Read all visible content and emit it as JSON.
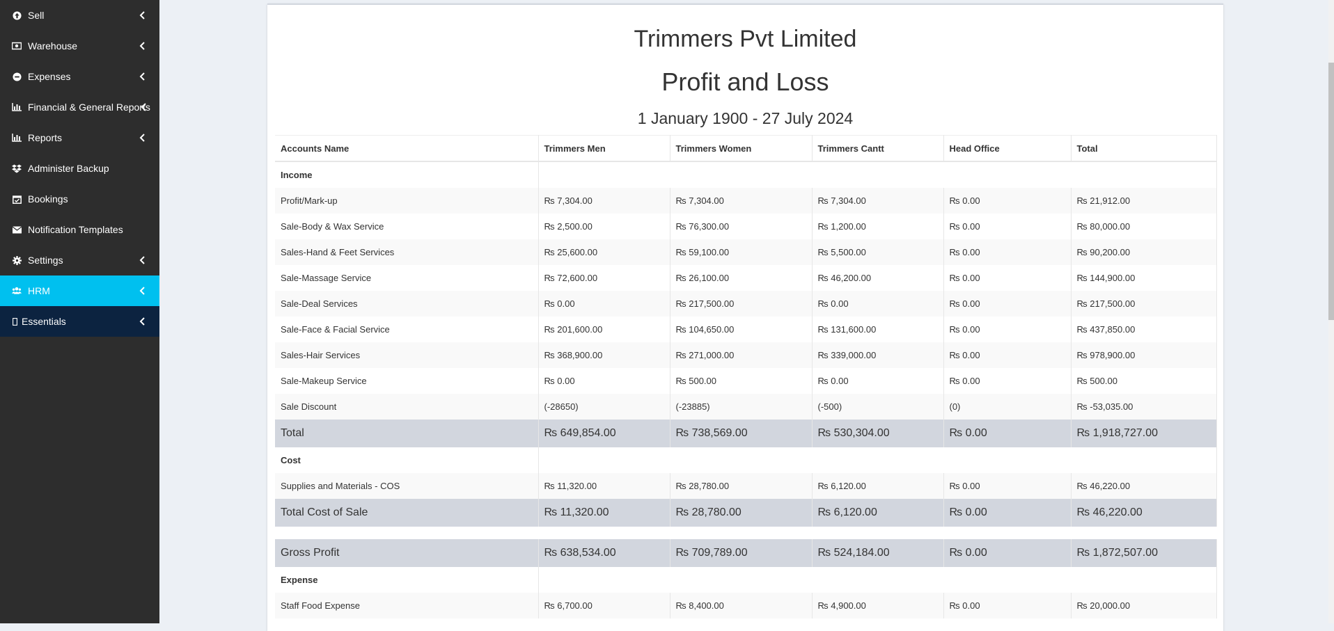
{
  "sidebar": {
    "items": [
      {
        "label": "Sell",
        "icon": "arrow-circle-up-icon",
        "chevron": true
      },
      {
        "label": "Warehouse",
        "icon": "money-icon",
        "chevron": true
      },
      {
        "label": "Expenses",
        "icon": "minus-circle-icon",
        "chevron": true
      },
      {
        "label": "Financial & General Reports",
        "icon": "bar-chart-icon",
        "chevron": true
      },
      {
        "label": "Reports",
        "icon": "bar-chart-icon",
        "chevron": true
      },
      {
        "label": "Administer Backup",
        "icon": "dropbox-icon",
        "chevron": false
      },
      {
        "label": "Bookings",
        "icon": "calendar-check-icon",
        "chevron": false
      },
      {
        "label": "Notification Templates",
        "icon": "envelope-icon",
        "chevron": false
      },
      {
        "label": "Settings",
        "icon": "gear-icon",
        "chevron": true
      },
      {
        "label": "HRM",
        "icon": "users-icon",
        "chevron": true,
        "active": true
      },
      {
        "label": "Essentials",
        "icon": "missing-glyph-icon",
        "chevron": true
      }
    ]
  },
  "report": {
    "company": "Trimmers Pvt Limited",
    "title": "Profit and Loss",
    "date_range": "1 January 1900 - 27 July 2024",
    "columns": [
      "Accounts Name",
      "Trimmers Men",
      "Trimmers Women",
      "Trimmers Cantt",
      "Head Office",
      "Total"
    ],
    "income": {
      "label": "Income",
      "rows": [
        [
          "Profit/Mark-up",
          "₨ 7,304.00",
          "₨ 7,304.00",
          "₨ 7,304.00",
          "₨ 0.00",
          "₨ 21,912.00"
        ],
        [
          "Sale-Body & Wax Service",
          "₨ 2,500.00",
          "₨ 76,300.00",
          "₨ 1,200.00",
          "₨ 0.00",
          "₨ 80,000.00"
        ],
        [
          "Sales-Hand & Feet Services",
          "₨ 25,600.00",
          "₨ 59,100.00",
          "₨ 5,500.00",
          "₨ 0.00",
          "₨ 90,200.00"
        ],
        [
          "Sale-Massage Service",
          "₨ 72,600.00",
          "₨ 26,100.00",
          "₨ 46,200.00",
          "₨ 0.00",
          "₨ 144,900.00"
        ],
        [
          "Sale-Deal Services",
          "₨ 0.00",
          "₨ 217,500.00",
          "₨ 0.00",
          "₨ 0.00",
          "₨ 217,500.00"
        ],
        [
          "Sale-Face & Facial Service",
          "₨ 201,600.00",
          "₨ 104,650.00",
          "₨ 131,600.00",
          "₨ 0.00",
          "₨ 437,850.00"
        ],
        [
          "Sales-Hair Services",
          "₨ 368,900.00",
          "₨ 271,000.00",
          "₨ 339,000.00",
          "₨ 0.00",
          "₨ 978,900.00"
        ],
        [
          "Sale-Makeup Service",
          "₨ 0.00",
          "₨ 500.00",
          "₨ 0.00",
          "₨ 0.00",
          "₨ 500.00"
        ],
        [
          "Sale Discount",
          "(-28650)",
          "(-23885)",
          "(-500)",
          "(0)",
          "₨ -53,035.00"
        ]
      ],
      "total": [
        "Total",
        "₨ 649,854.00",
        "₨ 738,569.00",
        "₨ 530,304.00",
        "₨ 0.00",
        "₨ 1,918,727.00"
      ]
    },
    "cost": {
      "label": "Cost",
      "rows": [
        [
          "Supplies and Materials - COS",
          "₨ 11,320.00",
          "₨ 28,780.00",
          "₨ 6,120.00",
          "₨ 0.00",
          "₨ 46,220.00"
        ]
      ],
      "total": [
        "Total Cost of Sale",
        "₨ 11,320.00",
        "₨ 28,780.00",
        "₨ 6,120.00",
        "₨ 0.00",
        "₨ 46,220.00"
      ]
    },
    "gross_profit": [
      "Gross Profit",
      "₨ 638,534.00",
      "₨ 709,789.00",
      "₨ 524,184.00",
      "₨ 0.00",
      "₨ 1,872,507.00"
    ],
    "expense": {
      "label": "Expense",
      "rows": [
        [
          "Staff Food Expense",
          "₨ 6,700.00",
          "₨ 8,400.00",
          "₨ 4,900.00",
          "₨ 0.00",
          "₨ 20,000.00"
        ]
      ]
    }
  }
}
